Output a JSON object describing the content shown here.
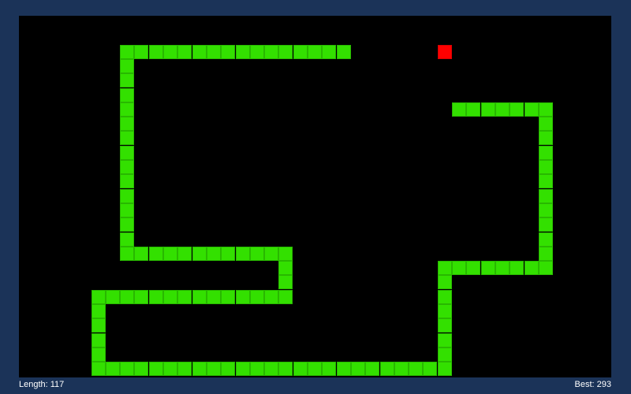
{
  "hud": {
    "length_text": "Length: 117",
    "best_text": "Best: 293"
  },
  "game": {
    "grid_columns": 41,
    "grid_rows": 25,
    "colors": {
      "background": "#1b3358",
      "board": "#000000",
      "snake": "#33e000",
      "snake_outline": "#28b800",
      "food": "#ff0000"
    },
    "food": [
      29,
      2
    ],
    "snake_path": [
      [
        22,
        2
      ],
      [
        7,
        2
      ],
      [
        7,
        16
      ],
      [
        18,
        16
      ],
      [
        18,
        19
      ],
      [
        5,
        19
      ],
      [
        5,
        24
      ],
      [
        29,
        24
      ],
      [
        29,
        17
      ],
      [
        36,
        17
      ],
      [
        36,
        6
      ],
      [
        30,
        6
      ]
    ]
  }
}
